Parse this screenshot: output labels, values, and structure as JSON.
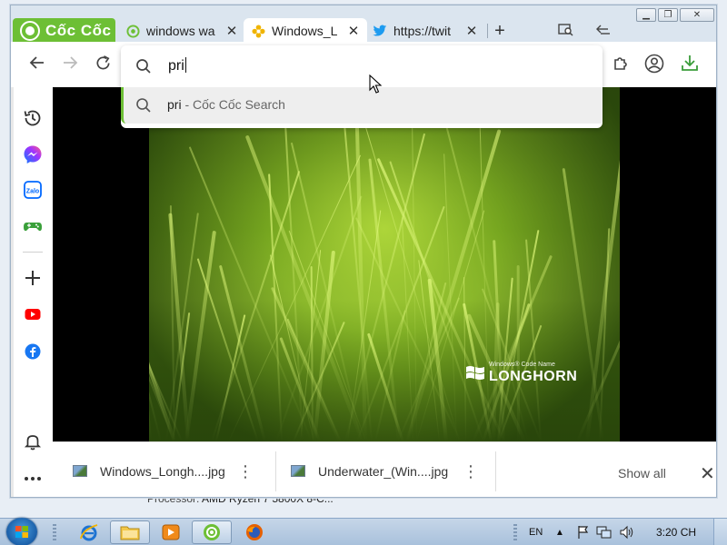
{
  "browser": {
    "brand": "Cốc Cốc",
    "tabs": [
      {
        "label": "windows wa",
        "icon": "coccoc-leaf-icon",
        "active": false
      },
      {
        "label": "Windows_L",
        "icon": "flower-icon",
        "active": true
      },
      {
        "label": "https://twit",
        "icon": "twitter-icon",
        "active": false
      }
    ],
    "omnibox": {
      "typed": "pri",
      "suggestion_query": "pri",
      "suggestion_suffix": " - Cốc Cốc Search"
    }
  },
  "image_watermark": {
    "small": "Windows® Code Name",
    "big": "LONGHORN"
  },
  "downloads": {
    "items": [
      {
        "name": "Windows_Longh....jpg"
      },
      {
        "name": "Underwater_(Win....jpg"
      }
    ],
    "show_all": "Show all"
  },
  "background_window": {
    "label": "Processor:",
    "value": "AMD Ryzen 7 5800X 8-C..."
  },
  "taskbar": {
    "language": "EN",
    "clock": "3:20 CH"
  },
  "colors": {
    "brand_green": "#6dbf35",
    "twitter_blue": "#1d9bf0"
  }
}
